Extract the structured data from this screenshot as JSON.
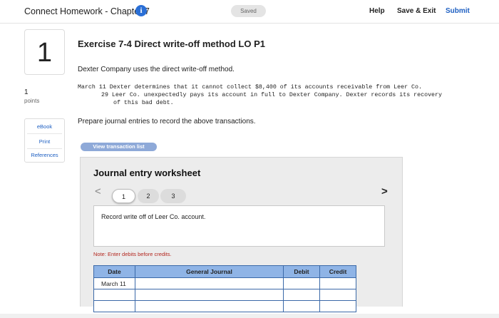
{
  "header": {
    "title": "Connect Homework - Chapter 7",
    "info_icon": "i",
    "saved": "Saved",
    "help": "Help",
    "save_exit": "Save & Exit",
    "submit": "Submit"
  },
  "question": {
    "number": "1",
    "points": "1",
    "points_label": "points"
  },
  "side_links": [
    "eBook",
    "Print",
    "References"
  ],
  "exercise": {
    "title": "Exercise 7-4 Direct write-off method LO P1",
    "intro": "Dexter Company uses the direct write-off method.",
    "transactions": [
      "March 11 Dexter determines that it cannot collect $8,400 of its accounts receivable from Leer Co.",
      "29 Leer Co. unexpectedly pays its account in full to Dexter Company. Dexter records its recovery",
      "of this bad debt."
    ],
    "instruction": "Prepare journal entries to record the above transactions."
  },
  "view_transaction_list": "View transaction list",
  "worksheet": {
    "title": "Journal entry worksheet",
    "prev_icon": "<",
    "next_icon": ">",
    "steps": [
      "1",
      "2",
      "3"
    ],
    "description": "Record write off of Leer Co. account.",
    "note": "Note: Enter debits before credits.",
    "columns": [
      "Date",
      "General Journal",
      "Debit",
      "Credit"
    ],
    "rows": [
      {
        "date": "March 11",
        "account": "",
        "debit": "",
        "credit": ""
      },
      {
        "date": "",
        "account": "",
        "debit": "",
        "credit": ""
      },
      {
        "date": "",
        "account": "",
        "debit": "",
        "credit": ""
      }
    ]
  },
  "colors": {
    "accent": "#1d5fc2",
    "table_header": "#8fb4e6",
    "note": "#b3261e"
  }
}
